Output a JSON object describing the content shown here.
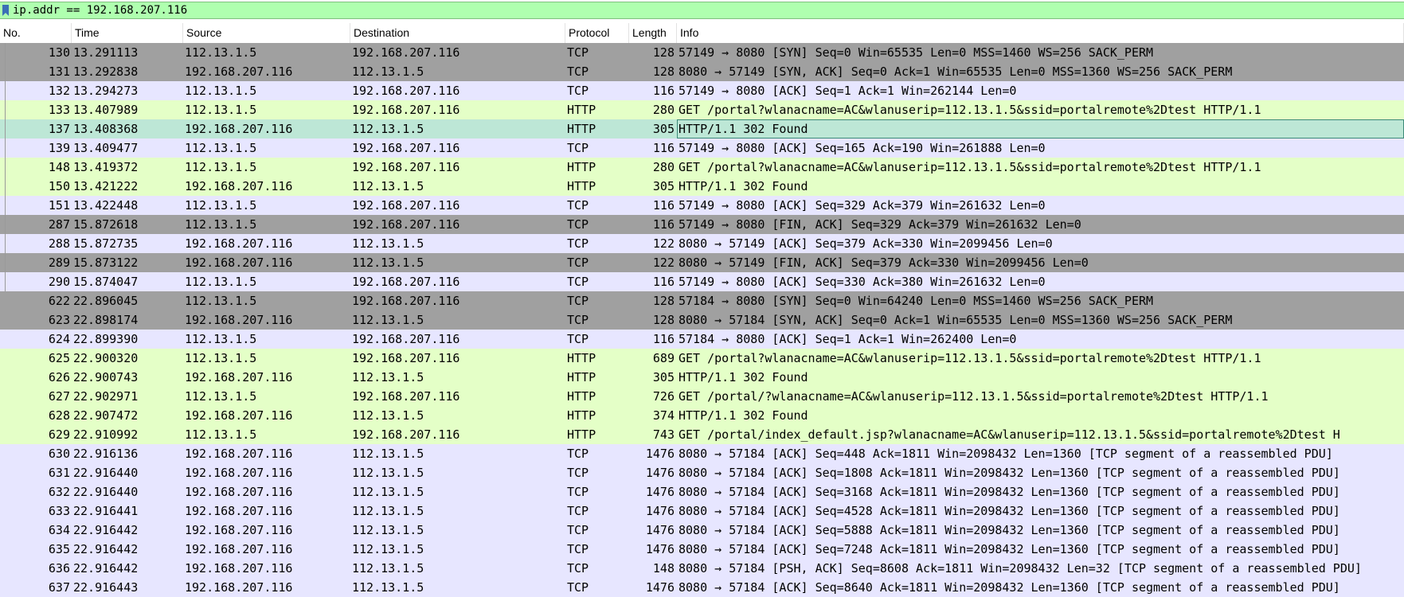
{
  "filter": {
    "text": "ip.addr == 192.168.207.116",
    "color": "#afffaf"
  },
  "columns": [
    "No.",
    "Time",
    "Source",
    "Destination",
    "Protocol",
    "Length",
    "Info"
  ],
  "colors": {
    "tcp": "#e7e6ff",
    "http": "#e4ffc7",
    "syn_fin": "#a0a0a0",
    "selected": "#bde7d6"
  },
  "rows": [
    {
      "no": "130",
      "time": "13.291113",
      "src": "112.13.1.5",
      "dst": "192.168.207.116",
      "proto": "TCP",
      "len": "128",
      "info": "57149 → 8080 [SYN] Seq=0 Win=65535 Len=0 MSS=1460 WS=256 SACK_PERM",
      "kind": "syn_fin"
    },
    {
      "no": "131",
      "time": "13.292838",
      "src": "192.168.207.116",
      "dst": "112.13.1.5",
      "proto": "TCP",
      "len": "128",
      "info": "8080 → 57149 [SYN, ACK] Seq=0 Ack=1 Win=65535 Len=0 MSS=1360 WS=256 SACK_PERM",
      "kind": "syn_fin"
    },
    {
      "no": "132",
      "time": "13.294273",
      "src": "112.13.1.5",
      "dst": "192.168.207.116",
      "proto": "TCP",
      "len": "116",
      "info": "57149 → 8080 [ACK] Seq=1 Ack=1 Win=262144 Len=0",
      "kind": "tcp"
    },
    {
      "no": "133",
      "time": "13.407989",
      "src": "112.13.1.5",
      "dst": "192.168.207.116",
      "proto": "HTTP",
      "len": "280",
      "info": "GET /portal?wlanacname=AC&wlanuserip=112.13.1.5&ssid=portalremote%2Dtest HTTP/1.1",
      "kind": "http"
    },
    {
      "no": "137",
      "time": "13.408368",
      "src": "192.168.207.116",
      "dst": "112.13.1.5",
      "proto": "HTTP",
      "len": "305",
      "info": "HTTP/1.1 302 Found",
      "kind": "selected"
    },
    {
      "no": "139",
      "time": "13.409477",
      "src": "112.13.1.5",
      "dst": "192.168.207.116",
      "proto": "TCP",
      "len": "116",
      "info": "57149 → 8080 [ACK] Seq=165 Ack=190 Win=261888 Len=0",
      "kind": "tcp"
    },
    {
      "no": "148",
      "time": "13.419372",
      "src": "112.13.1.5",
      "dst": "192.168.207.116",
      "proto": "HTTP",
      "len": "280",
      "info": "GET /portal?wlanacname=AC&wlanuserip=112.13.1.5&ssid=portalremote%2Dtest HTTP/1.1",
      "kind": "http"
    },
    {
      "no": "150",
      "time": "13.421222",
      "src": "192.168.207.116",
      "dst": "112.13.1.5",
      "proto": "HTTP",
      "len": "305",
      "info": "HTTP/1.1 302 Found",
      "kind": "http"
    },
    {
      "no": "151",
      "time": "13.422448",
      "src": "112.13.1.5",
      "dst": "192.168.207.116",
      "proto": "TCP",
      "len": "116",
      "info": "57149 → 8080 [ACK] Seq=329 Ack=379 Win=261632 Len=0",
      "kind": "tcp"
    },
    {
      "no": "287",
      "time": "15.872618",
      "src": "112.13.1.5",
      "dst": "192.168.207.116",
      "proto": "TCP",
      "len": "116",
      "info": "57149 → 8080 [FIN, ACK] Seq=329 Ack=379 Win=261632 Len=0",
      "kind": "syn_fin"
    },
    {
      "no": "288",
      "time": "15.872735",
      "src": "192.168.207.116",
      "dst": "112.13.1.5",
      "proto": "TCP",
      "len": "122",
      "info": "8080 → 57149 [ACK] Seq=379 Ack=330 Win=2099456 Len=0",
      "kind": "tcp"
    },
    {
      "no": "289",
      "time": "15.873122",
      "src": "192.168.207.116",
      "dst": "112.13.1.5",
      "proto": "TCP",
      "len": "122",
      "info": "8080 → 57149 [FIN, ACK] Seq=379 Ack=330 Win=2099456 Len=0",
      "kind": "syn_fin"
    },
    {
      "no": "290",
      "time": "15.874047",
      "src": "112.13.1.5",
      "dst": "192.168.207.116",
      "proto": "TCP",
      "len": "116",
      "info": "57149 → 8080 [ACK] Seq=330 Ack=380 Win=261632 Len=0",
      "kind": "tcp"
    },
    {
      "no": "622",
      "time": "22.896045",
      "src": "112.13.1.5",
      "dst": "192.168.207.116",
      "proto": "TCP",
      "len": "128",
      "info": "57184 → 8080 [SYN] Seq=0 Win=64240 Len=0 MSS=1460 WS=256 SACK_PERM",
      "kind": "syn_fin"
    },
    {
      "no": "623",
      "time": "22.898174",
      "src": "192.168.207.116",
      "dst": "112.13.1.5",
      "proto": "TCP",
      "len": "128",
      "info": "8080 → 57184 [SYN, ACK] Seq=0 Ack=1 Win=65535 Len=0 MSS=1360 WS=256 SACK_PERM",
      "kind": "syn_fin"
    },
    {
      "no": "624",
      "time": "22.899390",
      "src": "112.13.1.5",
      "dst": "192.168.207.116",
      "proto": "TCP",
      "len": "116",
      "info": "57184 → 8080 [ACK] Seq=1 Ack=1 Win=262400 Len=0",
      "kind": "tcp"
    },
    {
      "no": "625",
      "time": "22.900320",
      "src": "112.13.1.5",
      "dst": "192.168.207.116",
      "proto": "HTTP",
      "len": "689",
      "info": "GET /portal?wlanacname=AC&wlanuserip=112.13.1.5&ssid=portalremote%2Dtest HTTP/1.1",
      "kind": "http"
    },
    {
      "no": "626",
      "time": "22.900743",
      "src": "192.168.207.116",
      "dst": "112.13.1.5",
      "proto": "HTTP",
      "len": "305",
      "info": "HTTP/1.1 302 Found",
      "kind": "http"
    },
    {
      "no": "627",
      "time": "22.902971",
      "src": "112.13.1.5",
      "dst": "192.168.207.116",
      "proto": "HTTP",
      "len": "726",
      "info": "GET /portal/?wlanacname=AC&wlanuserip=112.13.1.5&ssid=portalremote%2Dtest HTTP/1.1",
      "kind": "http"
    },
    {
      "no": "628",
      "time": "22.907472",
      "src": "192.168.207.116",
      "dst": "112.13.1.5",
      "proto": "HTTP",
      "len": "374",
      "info": "HTTP/1.1 302 Found",
      "kind": "http"
    },
    {
      "no": "629",
      "time": "22.910992",
      "src": "112.13.1.5",
      "dst": "192.168.207.116",
      "proto": "HTTP",
      "len": "743",
      "info": "GET /portal/index_default.jsp?wlanacname=AC&wlanuserip=112.13.1.5&ssid=portalremote%2Dtest H",
      "kind": "http"
    },
    {
      "no": "630",
      "time": "22.916136",
      "src": "192.168.207.116",
      "dst": "112.13.1.5",
      "proto": "TCP",
      "len": "1476",
      "info": "8080 → 57184 [ACK] Seq=448 Ack=1811 Win=2098432 Len=1360 [TCP segment of a reassembled PDU]",
      "kind": "tcp"
    },
    {
      "no": "631",
      "time": "22.916440",
      "src": "192.168.207.116",
      "dst": "112.13.1.5",
      "proto": "TCP",
      "len": "1476",
      "info": "8080 → 57184 [ACK] Seq=1808 Ack=1811 Win=2098432 Len=1360 [TCP segment of a reassembled PDU]",
      "kind": "tcp"
    },
    {
      "no": "632",
      "time": "22.916440",
      "src": "192.168.207.116",
      "dst": "112.13.1.5",
      "proto": "TCP",
      "len": "1476",
      "info": "8080 → 57184 [ACK] Seq=3168 Ack=1811 Win=2098432 Len=1360 [TCP segment of a reassembled PDU]",
      "kind": "tcp"
    },
    {
      "no": "633",
      "time": "22.916441",
      "src": "192.168.207.116",
      "dst": "112.13.1.5",
      "proto": "TCP",
      "len": "1476",
      "info": "8080 → 57184 [ACK] Seq=4528 Ack=1811 Win=2098432 Len=1360 [TCP segment of a reassembled PDU]",
      "kind": "tcp"
    },
    {
      "no": "634",
      "time": "22.916442",
      "src": "192.168.207.116",
      "dst": "112.13.1.5",
      "proto": "TCP",
      "len": "1476",
      "info": "8080 → 57184 [ACK] Seq=5888 Ack=1811 Win=2098432 Len=1360 [TCP segment of a reassembled PDU]",
      "kind": "tcp"
    },
    {
      "no": "635",
      "time": "22.916442",
      "src": "192.168.207.116",
      "dst": "112.13.1.5",
      "proto": "TCP",
      "len": "1476",
      "info": "8080 → 57184 [ACK] Seq=7248 Ack=1811 Win=2098432 Len=1360 [TCP segment of a reassembled PDU]",
      "kind": "tcp"
    },
    {
      "no": "636",
      "time": "22.916442",
      "src": "192.168.207.116",
      "dst": "112.13.1.5",
      "proto": "TCP",
      "len": "148",
      "info": "8080 → 57184 [PSH, ACK] Seq=8608 Ack=1811 Win=2098432 Len=32 [TCP segment of a reassembled PDU]",
      "kind": "tcp"
    },
    {
      "no": "637",
      "time": "22.916443",
      "src": "192.168.207.116",
      "dst": "112.13.1.5",
      "proto": "TCP",
      "len": "1476",
      "info": "8080 → 57184 [ACK] Seq=8640 Ack=1811 Win=2098432 Len=1360 [TCP segment of a reassembled PDU]",
      "kind": "tcp"
    }
  ]
}
